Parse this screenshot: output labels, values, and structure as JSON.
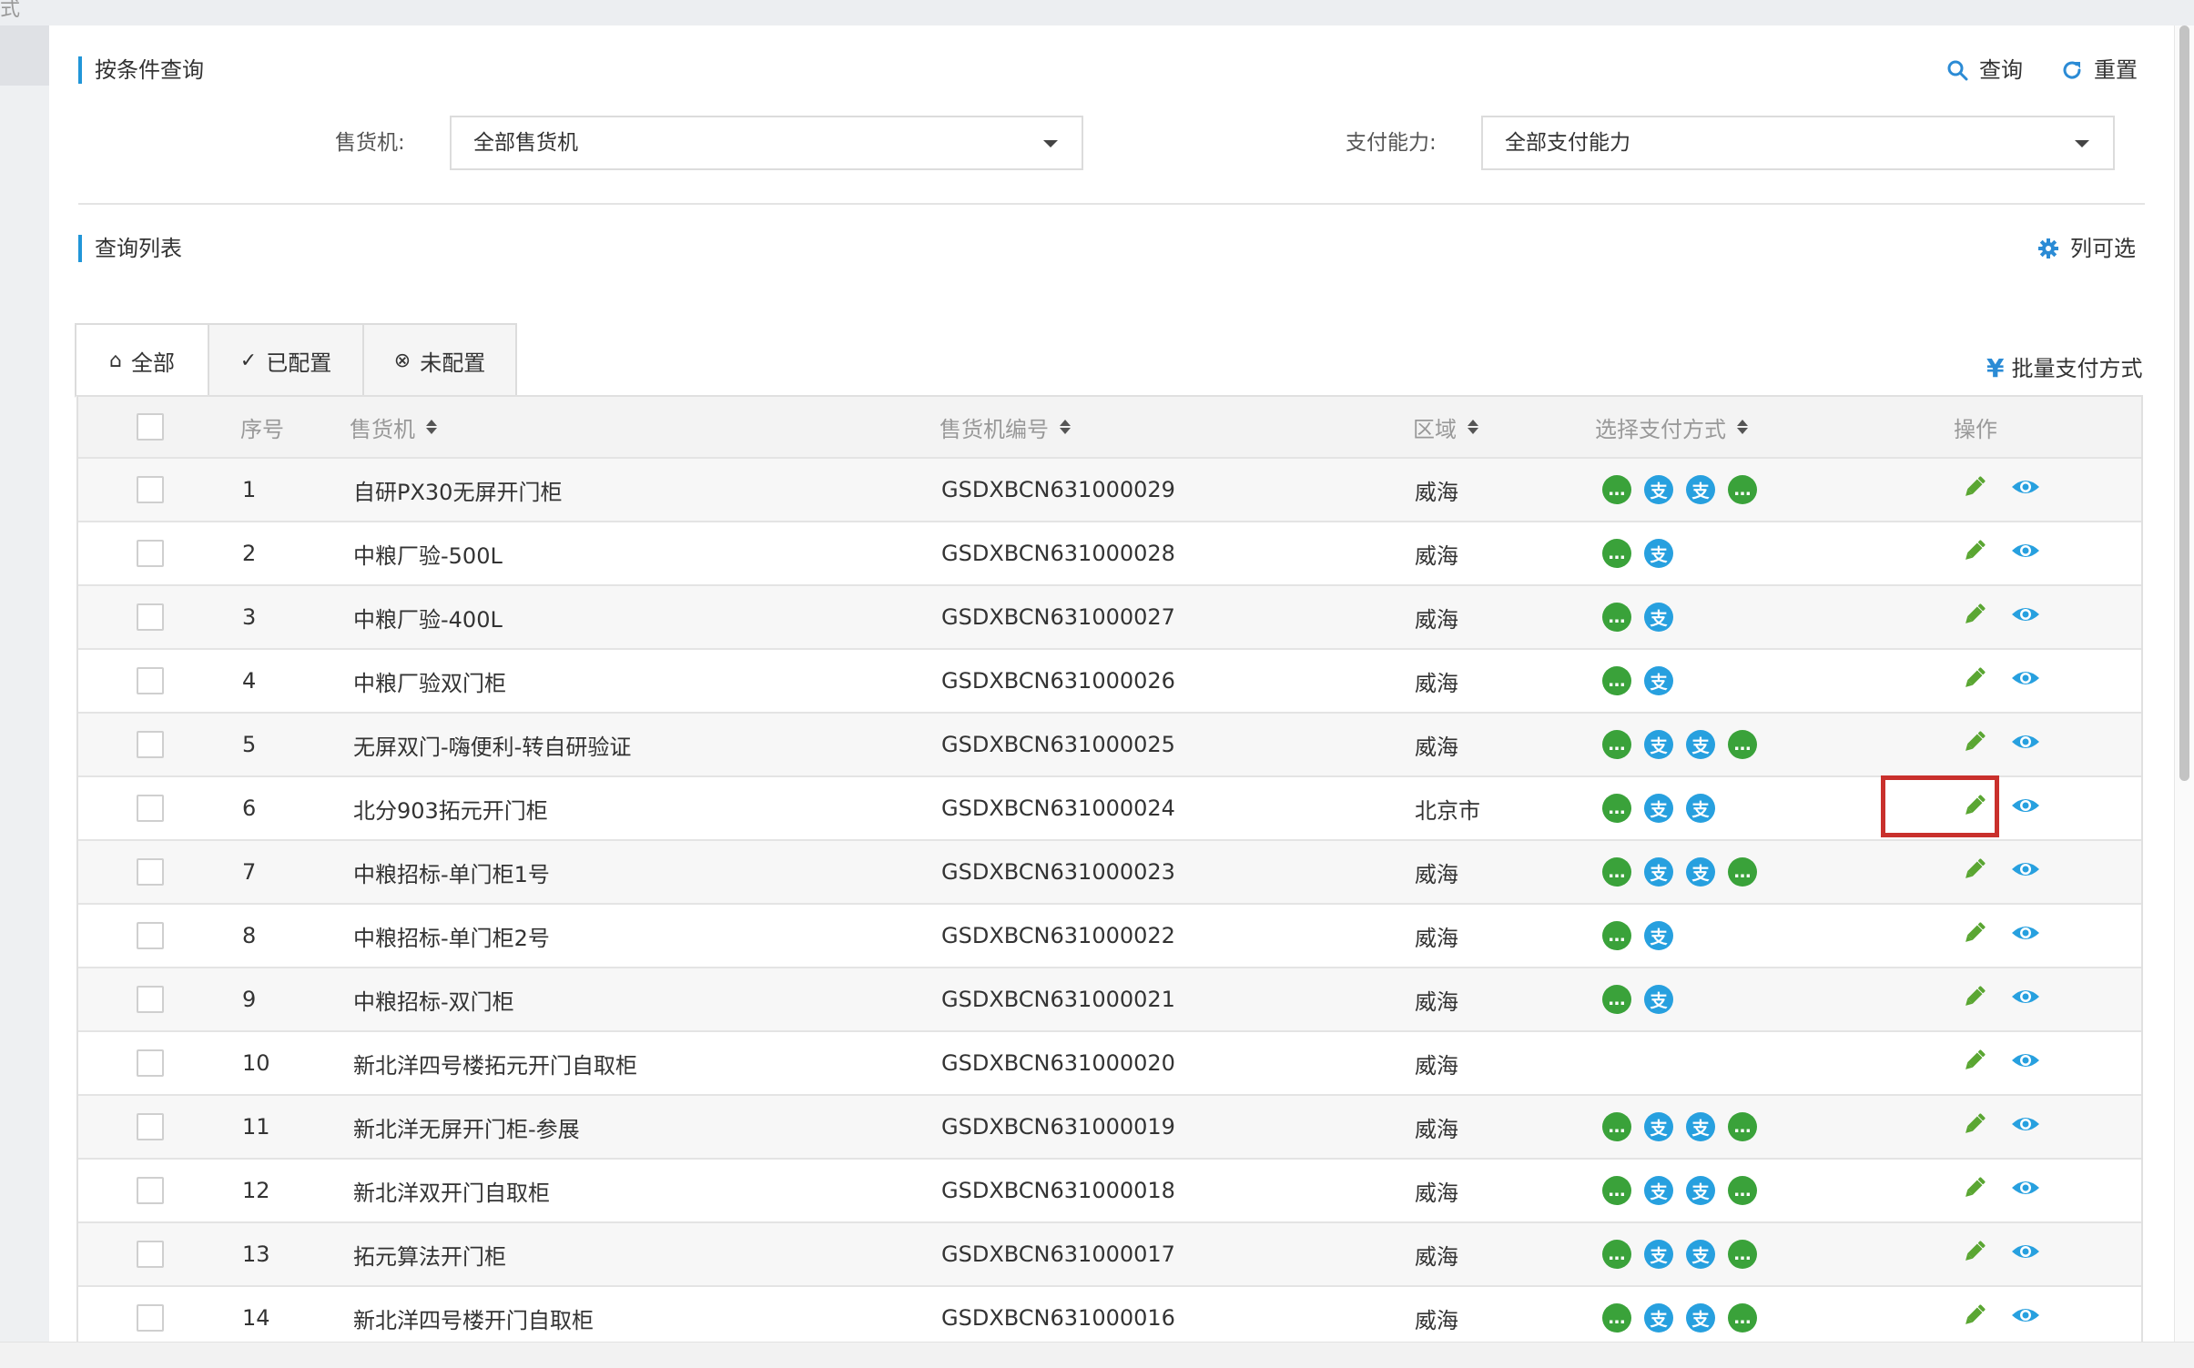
{
  "query": {
    "title": "按条件查询",
    "search_label": "查询",
    "reset_label": "重置",
    "machine_label": "售货机:",
    "machine_value": "全部售货机",
    "payment_label": "支付能力:",
    "payment_value": "全部支付能力"
  },
  "list": {
    "title": "查询列表",
    "columns_label": "列可选",
    "batch_label": "批量支付方式",
    "tabs": [
      {
        "label": "全部",
        "icon": "home-icon",
        "glyph": "⌂"
      },
      {
        "label": "已配置",
        "icon": "check-circle-icon",
        "glyph": "✓"
      },
      {
        "label": "未配置",
        "icon": "x-circle-icon",
        "glyph": "⊗"
      }
    ]
  },
  "table": {
    "headers": {
      "index": "序号",
      "machine": "售货机",
      "code": "售货机编号",
      "region": "区域",
      "payment": "选择支付方式",
      "ops": "操作"
    },
    "rows": [
      {
        "index": "1",
        "name": "自研PX30无屏开门柜",
        "code": "GSDXBCN631000029",
        "region": "威海",
        "pay": [
          "wechat",
          "alipay",
          "alipay",
          "wechat"
        ]
      },
      {
        "index": "2",
        "name": "中粮厂验-500L",
        "code": "GSDXBCN631000028",
        "region": "威海",
        "pay": [
          "wechat",
          "alipay"
        ]
      },
      {
        "index": "3",
        "name": "中粮厂验-400L",
        "code": "GSDXBCN631000027",
        "region": "威海",
        "pay": [
          "wechat",
          "alipay"
        ]
      },
      {
        "index": "4",
        "name": "中粮厂验双门柜",
        "code": "GSDXBCN631000026",
        "region": "威海",
        "pay": [
          "wechat",
          "alipay"
        ]
      },
      {
        "index": "5",
        "name": "无屏双门-嗨便利-转自研验证",
        "code": "GSDXBCN631000025",
        "region": "威海",
        "pay": [
          "wechat",
          "alipay",
          "alipay",
          "wechat"
        ]
      },
      {
        "index": "6",
        "name": "北分903拓元开门柜",
        "code": "GSDXBCN631000024",
        "region": "北京市",
        "pay": [
          "wechat",
          "alipay",
          "alipay"
        ]
      },
      {
        "index": "7",
        "name": "中粮招标-单门柜1号",
        "code": "GSDXBCN631000023",
        "region": "威海",
        "pay": [
          "wechat",
          "alipay",
          "alipay",
          "wechat"
        ]
      },
      {
        "index": "8",
        "name": "中粮招标-单门柜2号",
        "code": "GSDXBCN631000022",
        "region": "威海",
        "pay": [
          "wechat",
          "alipay"
        ]
      },
      {
        "index": "9",
        "name": "中粮招标-双门柜",
        "code": "GSDXBCN631000021",
        "region": "威海",
        "pay": [
          "wechat",
          "alipay"
        ]
      },
      {
        "index": "10",
        "name": "新北洋四号楼拓元开门自取柜",
        "code": "GSDXBCN631000020",
        "region": "威海",
        "pay": []
      },
      {
        "index": "11",
        "name": "新北洋无屏开门柜-参展",
        "code": "GSDXBCN631000019",
        "region": "威海",
        "pay": [
          "wechat",
          "alipay",
          "alipay",
          "wechat"
        ]
      },
      {
        "index": "12",
        "name": "新北洋双开门自取柜",
        "code": "GSDXBCN631000018",
        "region": "威海",
        "pay": [
          "wechat",
          "alipay",
          "alipay",
          "wechat"
        ]
      },
      {
        "index": "13",
        "name": "拓元算法开门柜",
        "code": "GSDXBCN631000017",
        "region": "威海",
        "pay": [
          "wechat",
          "alipay",
          "alipay",
          "wechat"
        ]
      },
      {
        "index": "14",
        "name": "新北洋四号楼开门自取柜",
        "code": "GSDXBCN631000016",
        "region": "威海",
        "pay": [
          "wechat",
          "alipay",
          "alipay",
          "wechat"
        ]
      }
    ]
  },
  "icons": {
    "wechat": "wechat-pay-icon",
    "alipay": "alipay-icon",
    "edit": "pencil-icon",
    "view": "eye-icon"
  },
  "colors": {
    "accent": "#2196d8",
    "wechat": "#3aa23a",
    "alipay": "#27a0df",
    "edit": "#5aa632",
    "highlight": "#c9302c"
  },
  "top_fragment": "式"
}
